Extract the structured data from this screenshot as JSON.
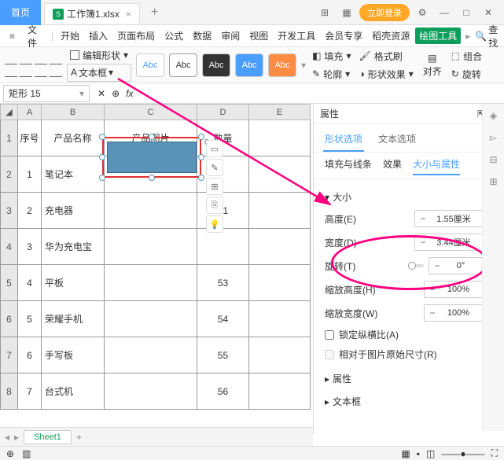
{
  "titlebar": {
    "home": "首页",
    "filename": "工作簿1.xlsx",
    "login": "立即登录"
  },
  "menu": {
    "file": "文件",
    "items": [
      "开始",
      "插入",
      "页面布局",
      "公式",
      "数据",
      "审阅",
      "视图",
      "开发工具",
      "会员专享",
      "稻壳资源"
    ],
    "active": "绘图工具",
    "search": "查找"
  },
  "toolbar": {
    "textbox": "文本框",
    "edit_shape": "编辑形状",
    "abc": "Abc",
    "fill": "填充",
    "outline": "轮廓",
    "effect": "形状效果",
    "format": "格式刷",
    "align": "对齐",
    "group": "组合",
    "rotate": "旋转"
  },
  "namebox": "矩形 15",
  "columns": [
    "A",
    "B",
    "C",
    "D",
    "E"
  ],
  "headers": {
    "a": "序号",
    "b": "产品名称",
    "c": "产品图片",
    "d": "数量"
  },
  "rows": [
    {
      "n": "1",
      "name": "笔记本",
      "qty": ""
    },
    {
      "n": "2",
      "name": "充电器",
      "qty": "51"
    },
    {
      "n": "3",
      "name": "华为充电宝",
      "qty": ""
    },
    {
      "n": "4",
      "name": "平板",
      "qty": "53"
    },
    {
      "n": "5",
      "name": "荣耀手机",
      "qty": "54"
    },
    {
      "n": "6",
      "name": "手写板",
      "qty": "55"
    },
    {
      "n": "7",
      "name": "台式机",
      "qty": "56"
    }
  ],
  "float_zero": "0",
  "sheet": "Sheet1",
  "panel": {
    "title": "属性",
    "tab_shape": "形状选项",
    "tab_text": "文本选项",
    "sub_fill": "填充与线条",
    "sub_effect": "效果",
    "sub_size": "大小与属性",
    "size": "大小",
    "height_label": "高度(E)",
    "height": "1.55厘米",
    "width_label": "宽度(D)",
    "width": "3.44厘米",
    "rotate_label": "旋转(T)",
    "rotate": "0°",
    "scale_h_label": "缩放高度(H)",
    "scale_h": "100%",
    "scale_w_label": "缩放宽度(W)",
    "scale_w": "100%",
    "lock_ratio": "锁定纵横比(A)",
    "relative": "相对于图片原始尺寸(R)",
    "props": "属性",
    "textbox_sec": "文本框"
  }
}
